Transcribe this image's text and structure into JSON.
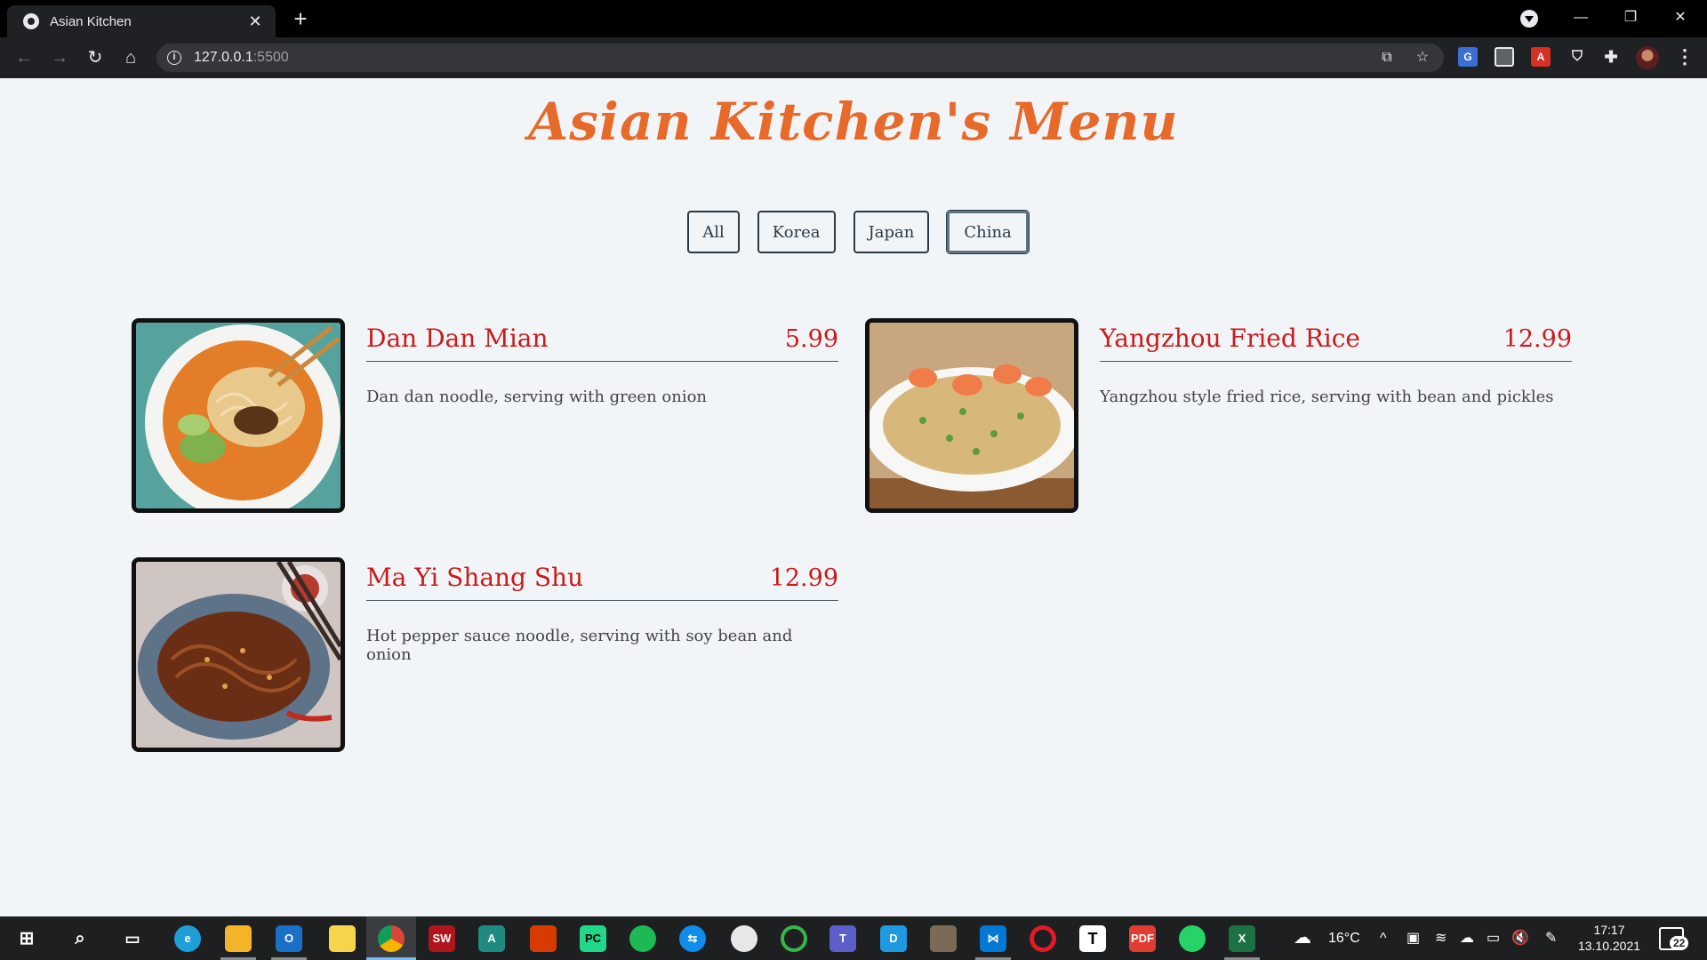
{
  "browser": {
    "tab_title": "Asian Kitchen",
    "url_host": "127.0.0.1",
    "url_port": ":5500"
  },
  "page": {
    "title": "Asian Kitchen's Menu",
    "filters": [
      "All",
      "Korea",
      "Japan",
      "China"
    ],
    "active_filter": "China",
    "items": [
      {
        "name": "Dan Dan Mian",
        "price": "5.99",
        "description": "Dan dan noodle, serving with green onion",
        "photo": "dan-dan-noodle-bowl"
      },
      {
        "name": "Yangzhou Fried Rice",
        "price": "12.99",
        "description": "Yangzhou style fried rice, serving with bean and pickles",
        "photo": "shrimp-fried-rice-plate"
      },
      {
        "name": "Ma Yi Shang Shu",
        "price": "12.99",
        "description": "Hot pepper sauce noodle, serving with soy bean and onion",
        "photo": "glass-noodle-plate"
      }
    ]
  },
  "taskbar": {
    "weather": "16°C",
    "time": "17:17",
    "date": "13.10.2021",
    "notifications": "22",
    "apps": [
      "start",
      "search",
      "task-view",
      "edge",
      "file-explorer",
      "outlook",
      "sticky-notes",
      "chrome",
      "solidworks",
      "app-a",
      "office",
      "pycharm",
      "spotify",
      "teamviewer",
      "paint",
      "app-ring",
      "teams",
      "app-d",
      "gimp",
      "vscode",
      "opera",
      "typora",
      "acrobat",
      "whatsapp",
      "excel"
    ]
  },
  "colors": {
    "title": "#e86a2a",
    "item_text": "#cb1a1a",
    "background": "#f1f5f8"
  }
}
